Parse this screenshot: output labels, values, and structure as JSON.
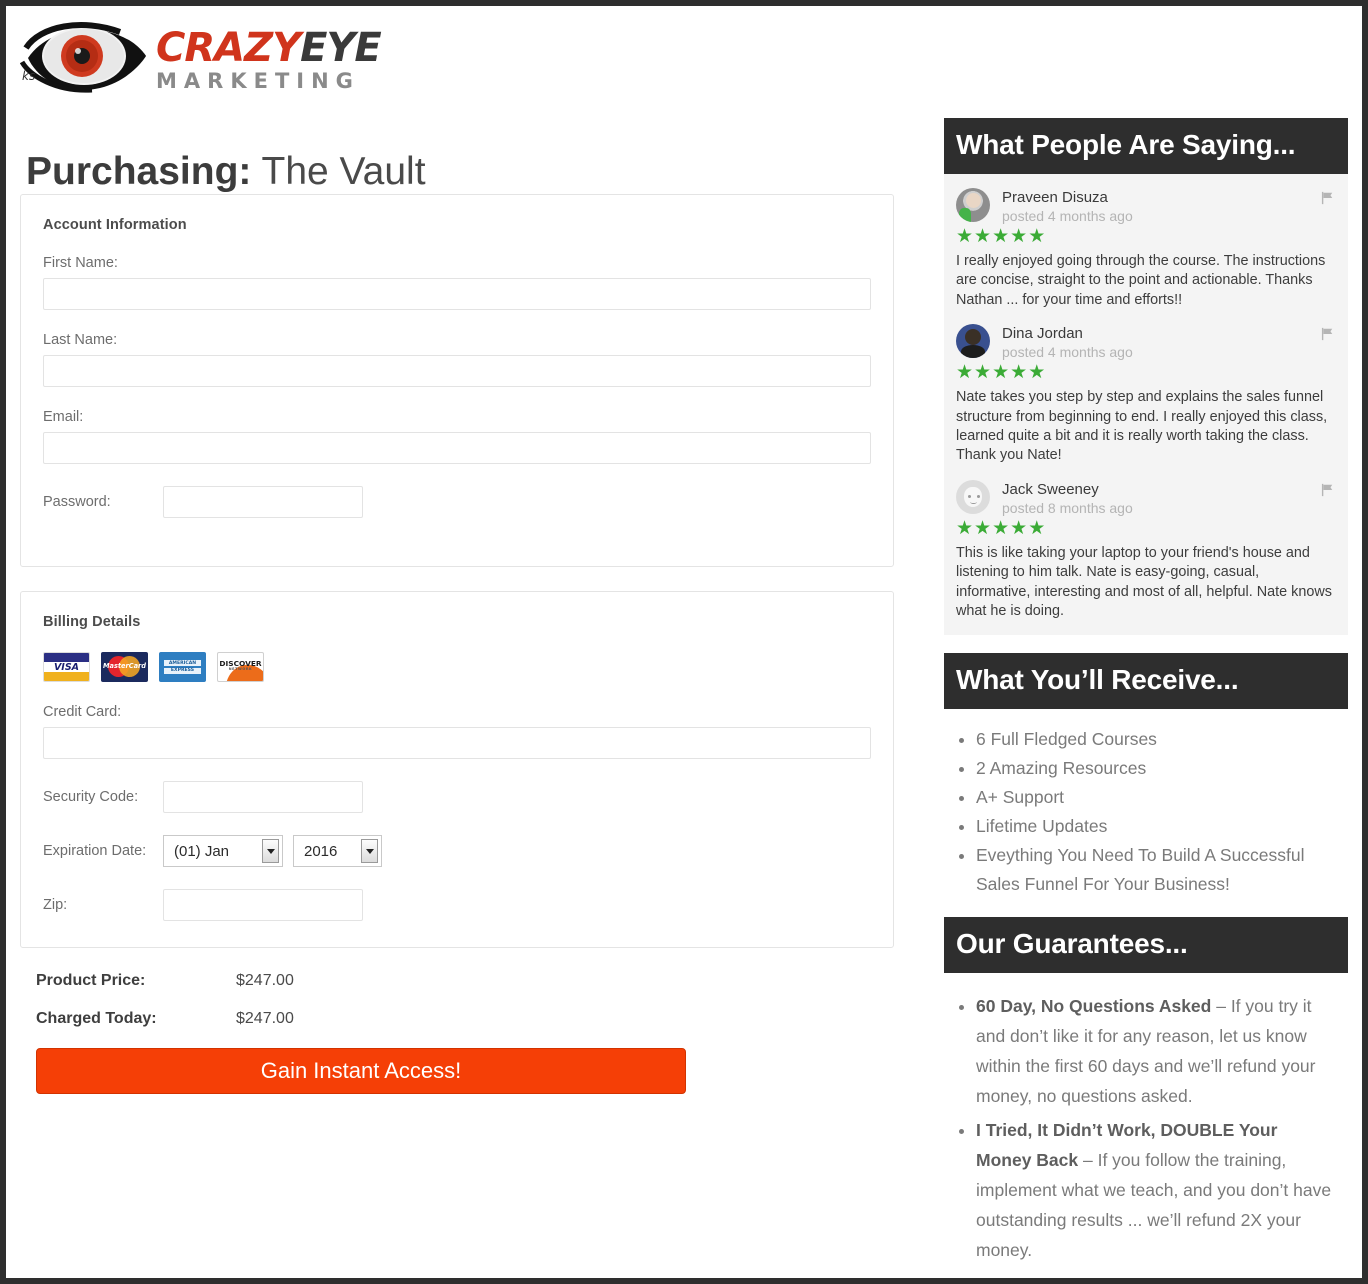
{
  "logo": {
    "word1": "CRAZY",
    "word2": "EYE",
    "tagline": "MARKETING",
    "icon": "eye-icon"
  },
  "page_title": {
    "bold_part": "Purchasing:",
    "light_part": " The Vault"
  },
  "account_section": {
    "title": "Account Information",
    "fields": [
      {
        "label": "First Name:",
        "value": "",
        "placeholder": ""
      },
      {
        "label": "Last Name:",
        "value": "",
        "placeholder": ""
      },
      {
        "label": "Email:",
        "value": "",
        "placeholder": ""
      },
      {
        "label": "Password:",
        "value": "",
        "placeholder": ""
      }
    ]
  },
  "billing_section": {
    "title": "Billing Details",
    "cards": [
      {
        "name": "visa-card-icon",
        "label": "VISA"
      },
      {
        "name": "mastercard-icon",
        "label": "MasterCard"
      },
      {
        "name": "amex-card-icon",
        "label": "AMERICAN EXPRESS"
      },
      {
        "name": "discover-card-icon",
        "label": "DISCOVER",
        "sublabel": "NETWORK"
      }
    ],
    "credit_card_label": "Credit Card:",
    "credit_card_value": "",
    "security_code_label": "Security Code:",
    "security_code_value": "",
    "expiration_label": "Expiration Date:",
    "expiration_month": "(01) Jan",
    "expiration_year": "2016",
    "zip_label": "Zip:",
    "zip_value": ""
  },
  "pricing": {
    "product_price_label": "Product Price:",
    "product_price_value": "$247.00",
    "charged_today_label": "Charged Today:",
    "charged_today_value": "$247.00",
    "cta_label": "Gain Instant Access!",
    "cta_color": "#f53f06"
  },
  "sidebar": {
    "testimonials_header": "What People Are Saying...",
    "star_color": "#3bab36",
    "testimonials": [
      {
        "name": "Praveen Disuza",
        "posted": "posted 4 months ago",
        "stars": 5,
        "text": "I really enjoyed going through the course. The instructions are concise, straight to the point and actionable. Thanks Nathan ... for your time and efforts!!"
      },
      {
        "name": "Dina Jordan",
        "posted": "posted 4 months ago",
        "stars": 5,
        "text": "Nate takes you step by step and explains the sales funnel structure from beginning to end. I really enjoyed this class, learned quite a bit and it is really worth taking the class. Thank you Nate!"
      },
      {
        "name": "Jack Sweeney",
        "posted": "posted 8 months ago",
        "stars": 5,
        "text": "This is like taking your laptop to your friend's house and listening to him talk. Nate is easy-going, casual, informative, interesting and most of all, helpful. Nate knows what he is doing."
      }
    ],
    "receive_header": "What You’ll Receive...",
    "receive_items": [
      "6 Full Fledged Courses",
      "2 Amazing Resources",
      "A+ Support",
      "Lifetime Updates",
      "Eveything You Need To Build A Successful Sales Funnel For Your Business!"
    ],
    "guarantees_header": "Our Guarantees...",
    "guarantees": [
      {
        "bold": "60 Day, No Questions Asked",
        "rest": " – If you try it and don’t like it for any reason, let us know within the first 60 days and we’ll refund your money, no questions asked."
      },
      {
        "bold": "I Tried, It Didn’t Work, DOUBLE Your Money Back",
        "rest": " – If you follow the training, implement what we teach, and you don’t have outstanding results ... we’ll refund 2X your money."
      }
    ]
  }
}
